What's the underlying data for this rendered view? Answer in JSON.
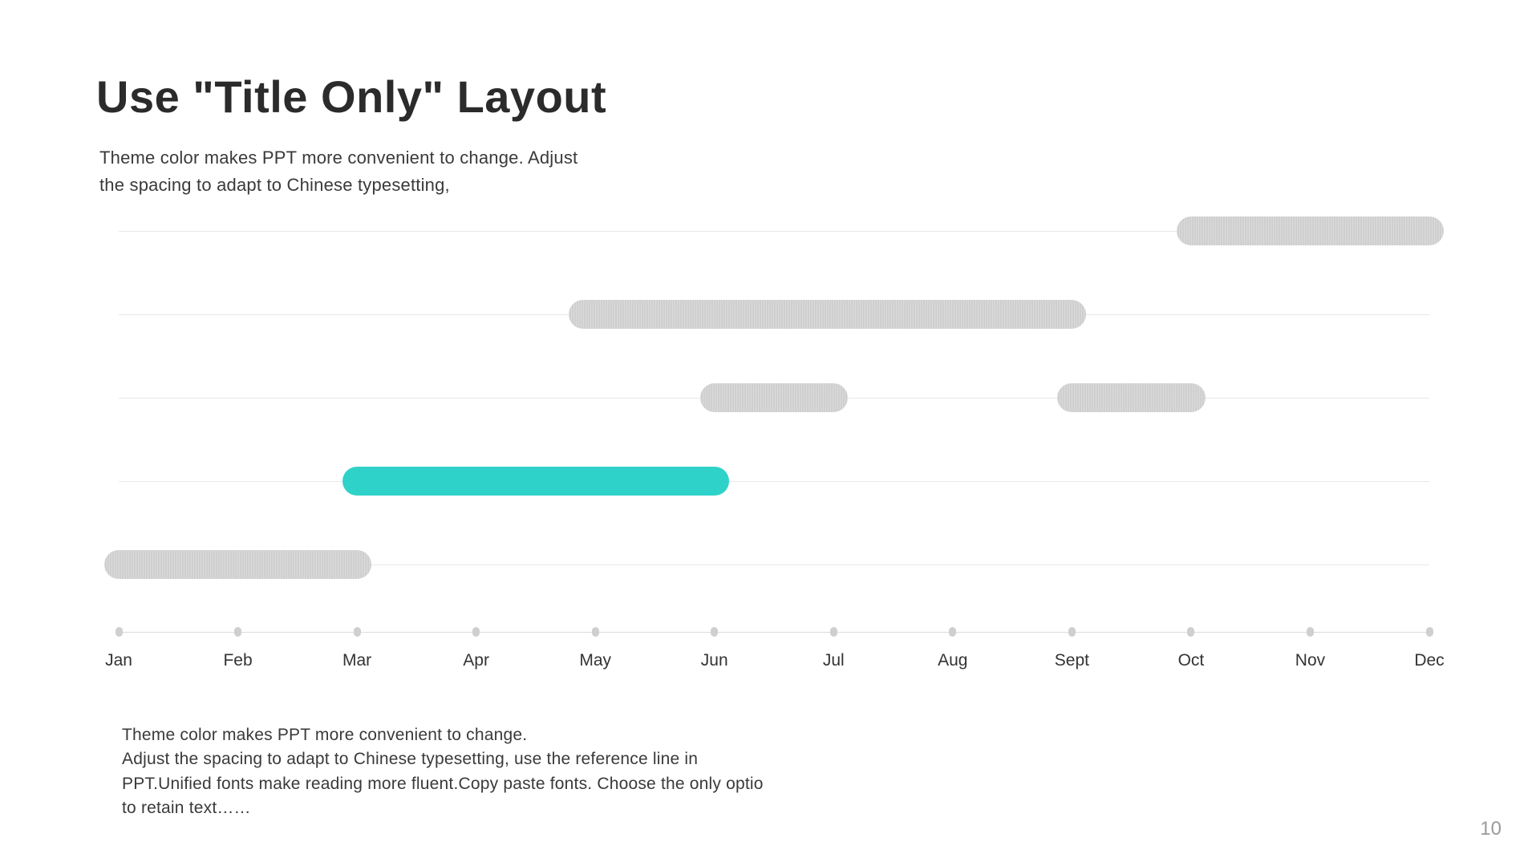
{
  "title": "Use \"Title Only\" Layout",
  "subtitle": "Theme color makes PPT more convenient to change. Adjust the spacing to adapt to Chinese typesetting,",
  "footer": "Theme  color makes PPT more convenient to change.\nAdjust the spacing to adapt to Chinese typesetting, use the reference line in PPT.Unified fonts make reading more fluent.Copy paste fonts. Choose the only optio to retain text……",
  "page_number": "10",
  "colors": {
    "accent": "#2fd2c8",
    "bar_grey": "#cfcfcf"
  },
  "chart_data": {
    "type": "bar",
    "orientation": "horizontal-gantt",
    "x_categories": [
      "Jan",
      "Feb",
      "Mar",
      "Apr",
      "May",
      "Jun",
      "Jul",
      "Aug",
      "Sept",
      "Oct",
      "Nov",
      "Dec"
    ],
    "rows": [
      {
        "segments": [
          {
            "start_index": 9,
            "end_index": 11,
            "color": "grey"
          }
        ]
      },
      {
        "segments": [
          {
            "start_index": 3.9,
            "end_index": 8.0,
            "color": "grey"
          }
        ]
      },
      {
        "segments": [
          {
            "start_index": 5,
            "end_index": 6.0,
            "color": "grey"
          },
          {
            "start_index": 8.0,
            "end_index": 9.0,
            "color": "grey"
          }
        ]
      },
      {
        "segments": [
          {
            "start_index": 2,
            "end_index": 5.0,
            "color": "accent"
          }
        ]
      },
      {
        "segments": [
          {
            "start_index": 0,
            "end_index": 2.0,
            "color": "grey"
          }
        ]
      }
    ],
    "row_count": 5
  }
}
